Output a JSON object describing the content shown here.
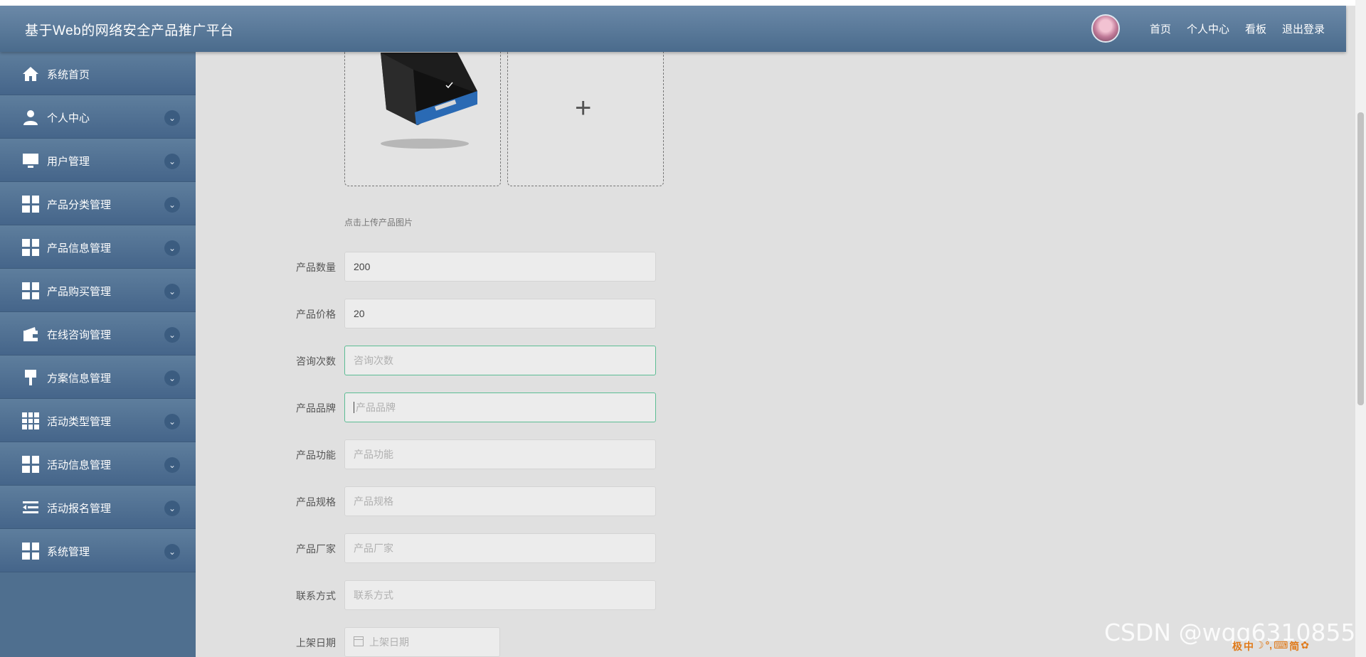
{
  "header": {
    "title": "基于Web的网络安全产品推广平台",
    "nav": [
      "首页",
      "个人中心",
      "看板",
      "退出登录"
    ]
  },
  "sidebar": {
    "items": [
      {
        "label": "系统首页",
        "icon": "home-icon"
      },
      {
        "label": "个人中心",
        "icon": "user-icon"
      },
      {
        "label": "用户管理",
        "icon": "monitor-icon"
      },
      {
        "label": "产品分类管理",
        "icon": "grid-icon"
      },
      {
        "label": "产品信息管理",
        "icon": "grid-icon"
      },
      {
        "label": "产品购买管理",
        "icon": "grid-icon"
      },
      {
        "label": "在线咨询管理",
        "icon": "wallet-icon"
      },
      {
        "label": "方案信息管理",
        "icon": "brush-icon"
      },
      {
        "label": "活动类型管理",
        "icon": "grid9-icon"
      },
      {
        "label": "活动信息管理",
        "icon": "grid-icon"
      },
      {
        "label": "活动报名管理",
        "icon": "list-indent-icon"
      },
      {
        "label": "系统管理",
        "icon": "grid-icon"
      }
    ]
  },
  "upload": {
    "tip": "点击上传产品图片",
    "add_icon": "plus-icon"
  },
  "form": {
    "quantity": {
      "label": "产品数量",
      "value": "200"
    },
    "price": {
      "label": "产品价格",
      "value": "20"
    },
    "consult_count": {
      "label": "咨询次数",
      "placeholder": "咨询次数"
    },
    "brand": {
      "label": "产品品牌",
      "placeholder": "产品品牌"
    },
    "function": {
      "label": "产品功能",
      "placeholder": "产品功能"
    },
    "spec": {
      "label": "产品规格",
      "placeholder": "产品规格"
    },
    "manufacturer": {
      "label": "产品厂家",
      "placeholder": "产品厂家"
    },
    "contact": {
      "label": "联系方式",
      "placeholder": "联系方式"
    },
    "listing_date": {
      "label": "上架日期",
      "placeholder": "上架日期"
    }
  },
  "watermark": "CSDN @wqq6310855",
  "ime": [
    "极",
    "中",
    "☽",
    "°,",
    "⌨",
    "简",
    "✿"
  ],
  "colors": {
    "header": "#5a7a9a",
    "sidebar": "#4f6f8f",
    "focus_border": "#5cbd94"
  }
}
